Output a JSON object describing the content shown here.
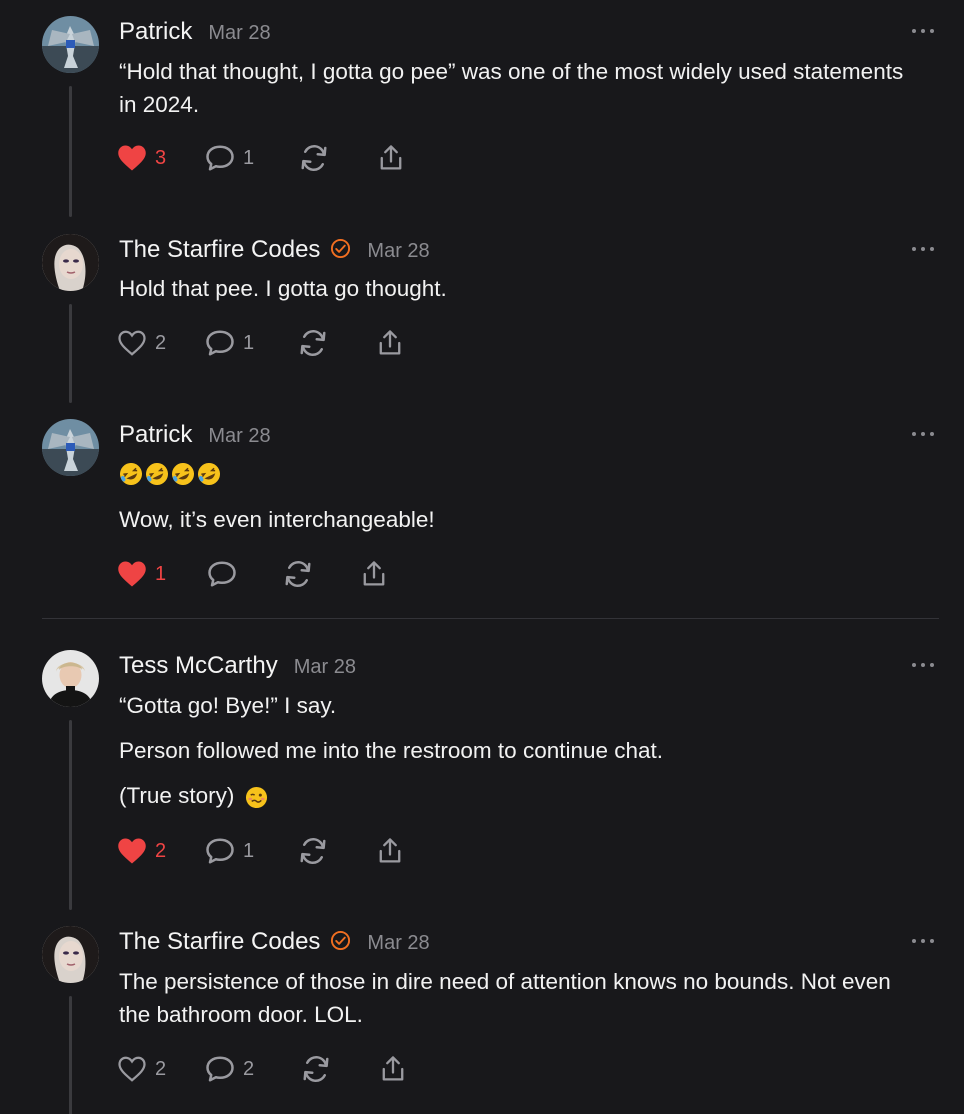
{
  "colors": {
    "background": "#18181b",
    "text": "#f2f2f2",
    "muted": "#8b8b90",
    "like_active": "#ef4444",
    "verified_badge": "#f26f21",
    "thread_line": "#3a3a3e"
  },
  "posts": [
    {
      "author": "Patrick",
      "date": "Mar 28",
      "verified": false,
      "paragraphs": [
        "“Hold that thought, I gotta go pee” was one of the most widely used statements in 2024."
      ],
      "likes": "3",
      "liked": true,
      "comments": "1"
    },
    {
      "author": "The Starfire Codes",
      "date": "Mar 28",
      "verified": true,
      "paragraphs": [
        "Hold that pee. I gotta go thought."
      ],
      "likes": "2",
      "liked": false,
      "comments": "1"
    },
    {
      "author": "Patrick",
      "date": "Mar 28",
      "verified": false,
      "emoji_line": "rolling-on-floor-laughing x4",
      "paragraphs": [
        "Wow, it’s even interchangeable!"
      ],
      "likes": "1",
      "liked": true,
      "comments": ""
    },
    {
      "author": "Tess McCarthy",
      "date": "Mar 28",
      "verified": false,
      "paragraphs": [
        "“Gotta go! Bye!” I say.",
        "Person followed me into the restroom to continue chat.",
        "(True story)"
      ],
      "trailing_emoji": "woozy-face",
      "likes": "2",
      "liked": true,
      "comments": "1"
    },
    {
      "author": "The Starfire Codes",
      "date": "Mar 28",
      "verified": true,
      "paragraphs": [
        "The persistence of those in dire need of attention knows no bounds. Not even the bathroom door. LOL."
      ],
      "likes": "2",
      "liked": false,
      "comments": "2"
    }
  ]
}
